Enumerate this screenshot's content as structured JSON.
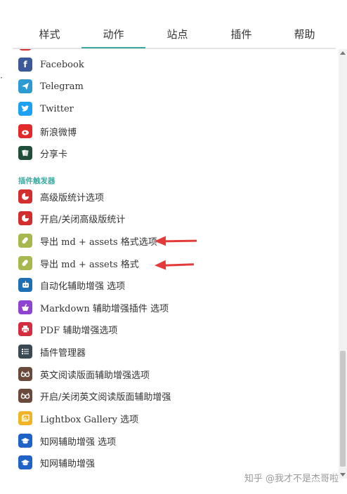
{
  "tabs": [
    {
      "label": "样式"
    },
    {
      "label": "动作"
    },
    {
      "label": "站点"
    },
    {
      "label": "插件"
    },
    {
      "label": "帮助"
    }
  ],
  "active_tab": "动作",
  "share_items": [
    {
      "label": "Facebook",
      "icon": "facebook-icon",
      "color": "#3b5998"
    },
    {
      "label": "Telegram",
      "icon": "telegram-icon",
      "color": "#2c9bd4"
    },
    {
      "label": "Twitter",
      "icon": "twitter-icon",
      "color": "#1da1f2"
    },
    {
      "label": "新浪微博",
      "icon": "weibo-icon",
      "color": "#e22a2a"
    },
    {
      "label": "分享卡",
      "icon": "share-card-icon",
      "color": "#1f4f3b"
    }
  ],
  "section_title": "插件触发器",
  "plugin_items": [
    {
      "label": "高级版统计选项",
      "icon": "stats-icon",
      "color": "#d22e2e"
    },
    {
      "label": "开启/关闭高级版统计",
      "icon": "stats-icon",
      "color": "#d22e2e"
    },
    {
      "label": "导出 md + assets 格式选项",
      "icon": "export-icon",
      "color": "#a8b84f"
    },
    {
      "label": "导出 md + assets 格式",
      "icon": "export-icon",
      "color": "#a8b84f"
    },
    {
      "label": "自动化辅助增强 选项",
      "icon": "robot-icon",
      "color": "#1f6fb4"
    },
    {
      "label": "Markdown 辅助增强插件 选项",
      "icon": "markdown-icon",
      "color": "#8e44d0"
    },
    {
      "label": "PDF 辅助增强选项",
      "icon": "printer-icon",
      "color": "#d22e40"
    },
    {
      "label": "插件管理器",
      "icon": "list-icon",
      "color": "#3a4a55"
    },
    {
      "label": "英文阅读版面辅助增强选项",
      "icon": "glasses-icon",
      "color": "#6a4a3a"
    },
    {
      "label": "开启/关闭英文阅读版面辅助增强",
      "icon": "glasses-icon",
      "color": "#6a4a3a"
    },
    {
      "label": "Lightbox Gallery 选项",
      "icon": "gallery-icon",
      "color": "#f0b429"
    },
    {
      "label": "知网辅助增强 选项",
      "icon": "graduation-cap-icon",
      "color": "#1f62c8"
    },
    {
      "label": "知网辅助增强",
      "icon": "graduation-cap-icon",
      "color": "#1f62c8"
    }
  ],
  "watermark": "知乎 @我才不是杰哥啦",
  "left_edge_mark": "·"
}
